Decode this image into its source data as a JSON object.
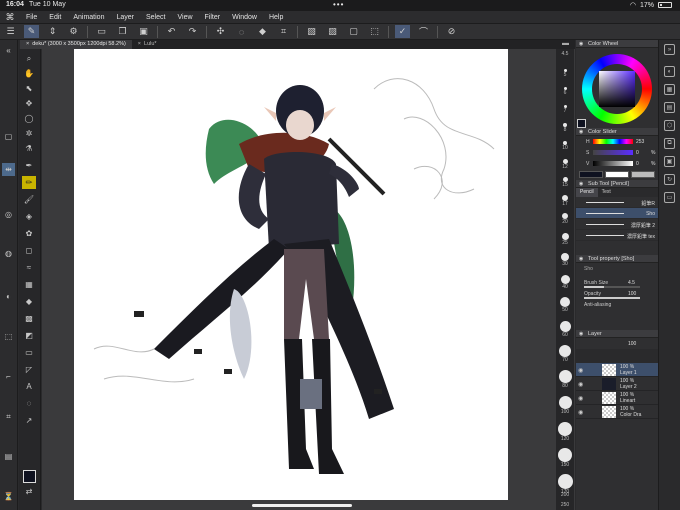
{
  "status": {
    "time": "16:04",
    "date": "Tue 10 May",
    "battery": "17%"
  },
  "menu": [
    "File",
    "Edit",
    "Animation",
    "Layer",
    "Select",
    "View",
    "Filter",
    "Window",
    "Help"
  ],
  "tabs": [
    {
      "label": "deku* (3000 x 3500px 1200dpi 58.2%)",
      "active": true
    },
    {
      "label": "Lulu*",
      "active": false
    }
  ],
  "panels": {
    "color_wheel": "Color Wheel",
    "color_slider": "Color Slider",
    "sliders": [
      {
        "label": "H",
        "value": "253",
        "unit": ""
      },
      {
        "label": "S",
        "value": "0",
        "unit": "%"
      },
      {
        "label": "V",
        "value": "0",
        "unit": "%"
      }
    ],
    "sub_tool": "Sub Tool [Pencil]",
    "sub_tool_tabs": [
      "Pencil",
      "Text"
    ],
    "brushes": [
      {
        "name": "鉛筆R",
        "active": false
      },
      {
        "name": "Sho",
        "active": true
      },
      {
        "name": "濃厚鉛筆 2",
        "active": false
      },
      {
        "name": "濃厚鉛筆 tex",
        "active": false
      }
    ],
    "tool_property": "Tool property [Sho]",
    "tool_property_name": "Sho",
    "properties": [
      {
        "label": "Brush Size",
        "value": "4.5",
        "fill": 0.35
      },
      {
        "label": "Opacity",
        "value": "100",
        "fill": 1.0
      },
      {
        "label": "Anti-aliasing",
        "value": "",
        "fill": 0.5
      }
    ],
    "layer_title": "Layer",
    "layer_opacity": "100",
    "layers": [
      {
        "pct": "100 %",
        "name": "Layer 1",
        "active": true
      },
      {
        "pct": "100 %",
        "name": "Layer 2",
        "active": false
      },
      {
        "pct": "100 %",
        "name": "Lineart",
        "active": false
      },
      {
        "pct": "100 %",
        "name": "Color Dra",
        "active": false
      }
    ]
  },
  "brush_sizes": [
    "4.5",
    "5",
    "6",
    "7",
    "8",
    "10",
    "12",
    "15",
    "17",
    "20",
    "25",
    "30",
    "40",
    "50",
    "60",
    "70",
    "80",
    "100",
    "120",
    "150",
    "170",
    "200",
    "250"
  ]
}
